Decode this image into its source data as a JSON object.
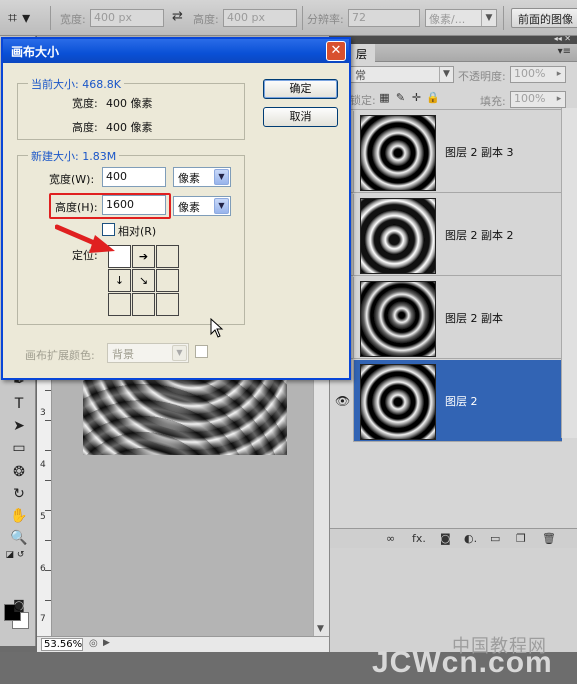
{
  "options_bar": {
    "width_label": "宽度:",
    "width_value": "400 px",
    "height_label": "高度:",
    "height_value": "400 px",
    "resolution_label": "分辨率:",
    "resolution_value": "72",
    "resolution_unit": "像素/...",
    "front_image_button": "前面的图像"
  },
  "dialog": {
    "title": "画布大小",
    "current_size_legend": "当前大小: 468.8K",
    "current_width_label": "宽度:",
    "current_width_value": "400 像素",
    "current_height_label": "高度:",
    "current_height_value": "400 像素",
    "new_size_legend": "新建大小: 1.83M",
    "width_label": "宽度(W):",
    "width_value": "400",
    "width_unit": "像素",
    "height_label": "高度(H):",
    "height_value": "1600",
    "height_unit": "像素",
    "relative_label": "相对(R)",
    "anchor_label": "定位:",
    "extension_color_label": "画布扩展颜色:",
    "extension_color_value": "背景",
    "ok_button": "确定",
    "cancel_button": "取消"
  },
  "layers_panel": {
    "tab_label": "层",
    "blend_mode": "常",
    "opacity_label": "不透明度:",
    "opacity_value": "100%",
    "lock_label": "锁定:",
    "fill_label": "填充:",
    "fill_value": "100%",
    "layers": [
      {
        "name": "图层 2 副本 3",
        "selected": false
      },
      {
        "name": "图层 2 副本 2",
        "selected": false
      },
      {
        "name": "图层 2 副本",
        "selected": false
      },
      {
        "name": "图层 2",
        "selected": true
      }
    ]
  },
  "status": {
    "zoom": "53.56%"
  },
  "ruler": {
    "numbers": [
      "3",
      "4",
      "5",
      "6",
      "7"
    ]
  },
  "watermark": {
    "chinese": "中国教程网",
    "english": "JCWcn.com"
  },
  "colors": {
    "accent": "#0a50d6",
    "selected_layer": "#3264b4",
    "highlight_red": "#e02020"
  }
}
